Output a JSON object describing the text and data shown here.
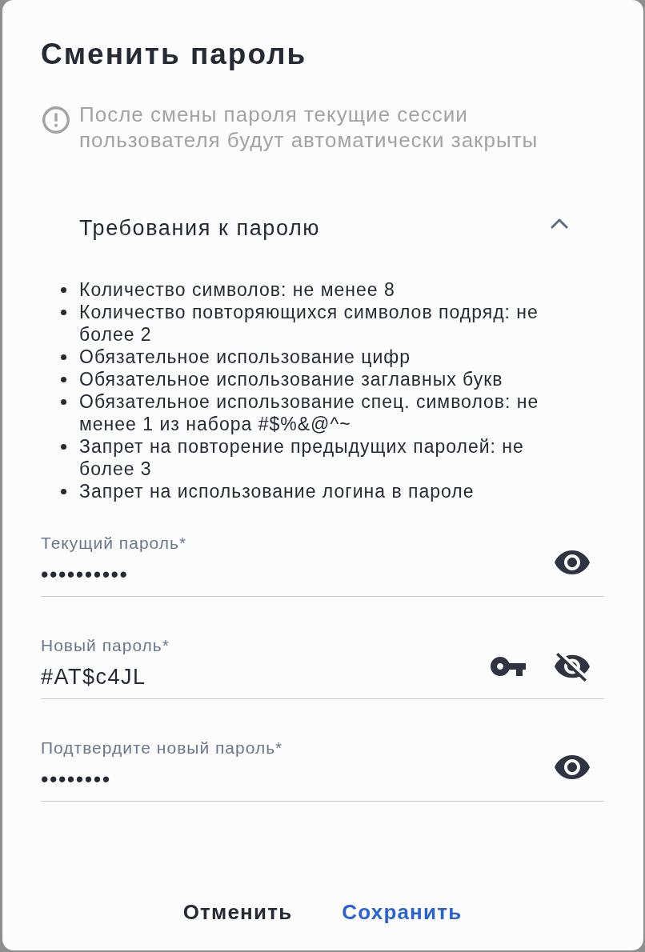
{
  "dialog": {
    "title": "Сменить пароль"
  },
  "notice": {
    "text": "После смены пароля текущие сессии пользователя будут автоматически закрыты"
  },
  "requirements": {
    "title": "Требования к паролю",
    "expanded": true,
    "items": [
      "Количество символов: не менее 8",
      "Количество повторяющихся символов подряд: не более 2",
      "Обязательное использование цифр",
      "Обязательное использование заглавных букв",
      "Обязательное использование спец. символов: не менее 1 из набора #$%&@^~",
      "Запрет на повторение предыдущих паролей: не более 3",
      "Запрет на использование логина в пароле"
    ]
  },
  "fields": [
    {
      "label": "Текущий пароль*",
      "value": "••••••••••",
      "revealed": false,
      "generator": false
    },
    {
      "label": "Новый пароль*",
      "value": "#AT$c4JL",
      "revealed": true,
      "generator": true
    },
    {
      "label": "Подтвердите новый пароль*",
      "value": "••••••••",
      "revealed": false,
      "generator": false
    }
  ],
  "buttons": [
    {
      "label": "Отменить",
      "kind": "secondary"
    },
    {
      "label": "Сохранить",
      "kind": "primary"
    }
  ]
}
